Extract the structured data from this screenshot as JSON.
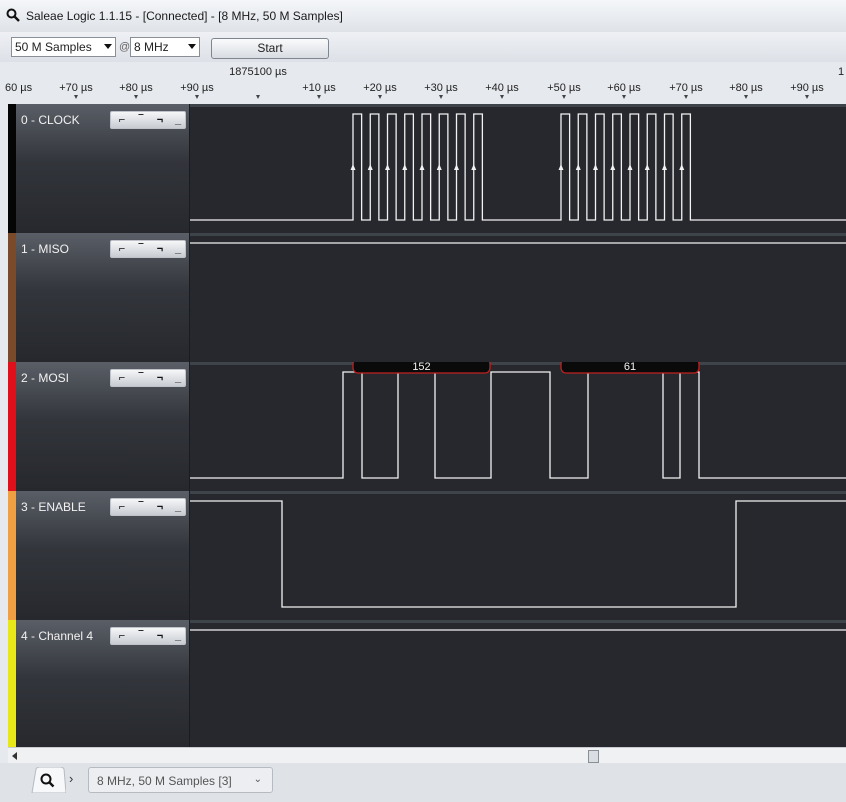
{
  "window": {
    "title": "Saleae Logic 1.1.15 - [Connected] - [8 MHz, 50 M Samples]"
  },
  "toolbar": {
    "samples_value": "50 M Samples",
    "at_label": "@",
    "rate_value": "8 MHz",
    "start_label": "Start"
  },
  "ruler": {
    "reference": "1875100 µs",
    "left_edge": "60 µs",
    "right_edge": "1",
    "ticks": [
      "+70 µs",
      "+80 µs",
      "+90 µs",
      "+10 µs",
      "+20 µs",
      "+30 µs",
      "+40 µs",
      "+50 µs",
      "+60 µs",
      "+70 µs",
      "+80 µs",
      "+90 µs"
    ]
  },
  "channels": [
    {
      "name": "0 - CLOCK",
      "color": "#050505"
    },
    {
      "name": "1 - MISO",
      "color": "#7a4a2a"
    },
    {
      "name": "2 - MOSI",
      "color": "#e0101a"
    },
    {
      "name": "3 - ENABLE",
      "color": "#f0a040"
    },
    {
      "name": "4 - Channel 4",
      "color": "#e8e818"
    }
  ],
  "trigger_buttons": [
    "rising-edge",
    "high",
    "falling-edge",
    "low"
  ],
  "annotations": [
    {
      "channel": "2 - MOSI",
      "value": "152"
    },
    {
      "channel": "2 - MOSI",
      "value": "61"
    }
  ],
  "tabs": {
    "session": "8 MHz, 50 M Samples [3]",
    "next": "›"
  }
}
